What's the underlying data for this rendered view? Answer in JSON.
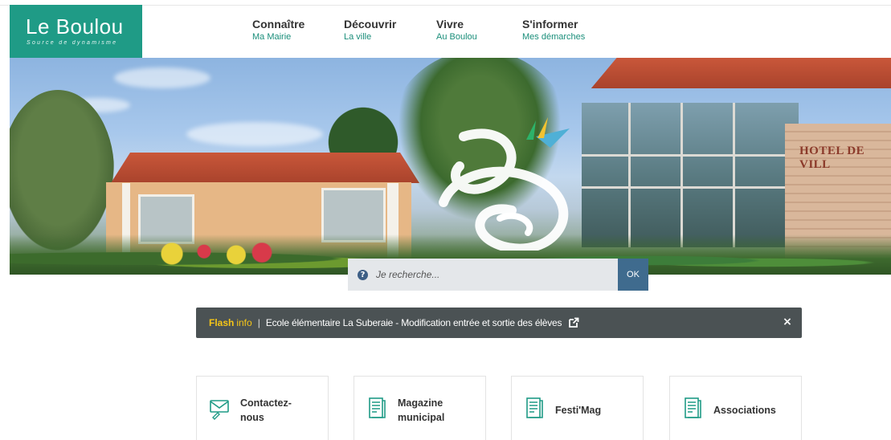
{
  "logo": {
    "title": "Le Boulou",
    "tagline": "Source de dynamisme",
    "bg_color": "#1f9b86"
  },
  "nav": [
    {
      "main": "Connaître",
      "sub": "Ma Mairie"
    },
    {
      "main": "Découvrir",
      "sub": "La ville"
    },
    {
      "main": "Vivre",
      "sub": "Au Boulou"
    },
    {
      "main": "S'informer",
      "sub": "Mes démarches"
    }
  ],
  "hero": {
    "sign": "HOTEL DE VILL"
  },
  "search": {
    "icon": "question-circle-icon",
    "placeholder": "Je recherche...",
    "button_label": "OK"
  },
  "flash": {
    "label_a": "Flash",
    "label_b": "info",
    "separator": "|",
    "text": "Ecole élémentaire La Suberaie - Modification entrée et sortie des élèves",
    "link_icon": "external-link-icon",
    "close_icon": "close-icon",
    "close_label": "×",
    "bg_color": "#4b5254",
    "accent_color": "#f5c518"
  },
  "cards": [
    {
      "label": "Contactez-\nnous",
      "icon": "envelope-icon"
    },
    {
      "label": "Magazine\nmunicipal",
      "icon": "magazine-icon"
    },
    {
      "label": "Festi'Mag",
      "icon": "magazine-icon"
    },
    {
      "label": "Associations",
      "icon": "magazine-icon"
    }
  ],
  "colors": {
    "nav_sub": "#1a8e7a",
    "icon_teal": "#1f9b86",
    "search_button": "#3f6b8e"
  }
}
